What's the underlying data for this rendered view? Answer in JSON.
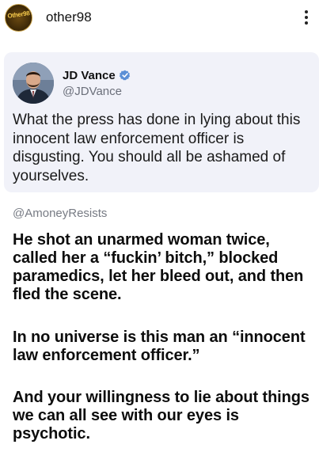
{
  "header": {
    "avatar_text": "Other98",
    "username": "other98",
    "more_icon": "vertical-ellipsis-icon"
  },
  "quoted_post": {
    "display_name": "JD Vance",
    "handle": "@JDVance",
    "verified_icon": "verified-badge-icon",
    "verified_color": "#5b8fd6",
    "text": "What the press has done in lying about this innocent law enforcement officer is disgusting. You should all be ashamed of yourselves.",
    "background": "#f1f2f9"
  },
  "reply": {
    "handle": "@AmoneyResists",
    "paragraphs": [
      "He shot an unarmed woman twice, called her a “fuckin’ bitch,” blocked paramedics, let her bleed out, and then fled the scene.",
      "In no universe is this man an “innocent law enforcement officer.”",
      "And your willingness to lie about things we can all see with our eyes is psychotic."
    ]
  }
}
